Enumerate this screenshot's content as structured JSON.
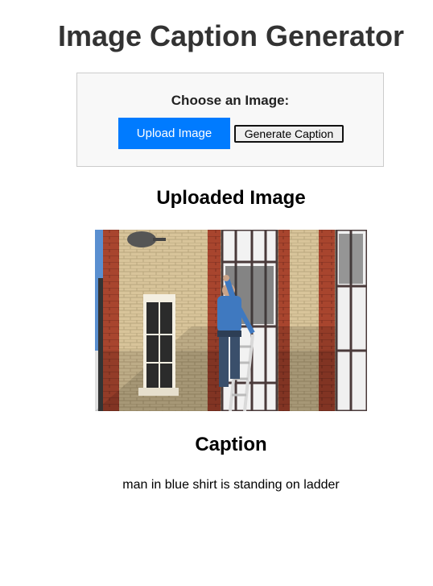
{
  "header": {
    "title": "Image Caption Generator"
  },
  "upload_panel": {
    "label": "Choose an Image:",
    "upload_button": "Upload Image",
    "generate_button": "Generate Caption"
  },
  "uploaded_section": {
    "heading": "Uploaded Image",
    "image_alt": "man in blue shirt on ladder cleaning window of brick building"
  },
  "caption_section": {
    "heading": "Caption",
    "text": "man in blue shirt is standing on ladder"
  },
  "colors": {
    "accent": "#007bff",
    "title": "#333333",
    "panel_bg": "#f8f8f8",
    "panel_border": "#cccccc"
  }
}
